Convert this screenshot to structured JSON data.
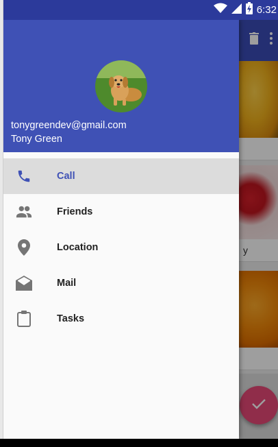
{
  "status_bar": {
    "time": "6:32",
    "icons": [
      "wifi-icon",
      "signal-icon",
      "battery-icon"
    ]
  },
  "background_app": {
    "app_bar_icons": [
      "delete-icon",
      "overflow-menu-icon"
    ],
    "cards": [
      {
        "image": "bananas",
        "label": ""
      },
      {
        "image": "strawberry",
        "label": "y"
      },
      {
        "image": "oranges",
        "label": ""
      }
    ],
    "fab_icon": "check-icon"
  },
  "drawer": {
    "header": {
      "avatar": "puppy-photo",
      "email": "tonygreendev@gmail.com",
      "name": "Tony Green"
    },
    "items": [
      {
        "label": "Call",
        "icon": "phone-icon",
        "selected": true
      },
      {
        "label": "Friends",
        "icon": "people-icon",
        "selected": false
      },
      {
        "label": "Location",
        "icon": "location-pin-icon",
        "selected": false
      },
      {
        "label": "Mail",
        "icon": "mail-icon",
        "selected": false
      },
      {
        "label": "Tasks",
        "icon": "clipboard-icon",
        "selected": false
      }
    ]
  },
  "colors": {
    "primary": "#3f51b5",
    "primary_dark": "#2c3a9b",
    "accent": "#e84a78",
    "selected_background": "#dcdcdc"
  }
}
